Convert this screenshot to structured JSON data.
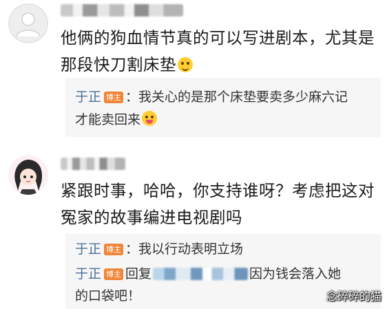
{
  "comments": [
    {
      "text": "他俩的狗血情节真的可以写进剧本，尤其是那段快刀割床垫",
      "emoji": "laughing-crying-emoji",
      "replies": [
        {
          "author": "于正",
          "badge": "博主",
          "separator": "：",
          "text_line1": "我关心的是那个床垫要卖多少麻六记",
          "text_line2": "才能卖回来",
          "emoji": "tongue-out-emoji"
        }
      ]
    },
    {
      "text": "紧跟时事，哈哈，你支持谁呀？考虑把这对冤家的故事编进电视剧吗",
      "replies": [
        {
          "author": "于正",
          "badge": "博主",
          "separator": "：",
          "text": "我以行动表明立场"
        },
        {
          "author": "于正",
          "badge": "博主",
          "reply_word": "回复",
          "text_line1": "因为钱会落入她",
          "text_line2": "的口袋吧！"
        }
      ]
    }
  ],
  "watermark": "念碎碎的猫",
  "colors": {
    "author_link": "#4a6f99",
    "badge": "#f08437",
    "reply_bg": "#f6f6f6"
  }
}
